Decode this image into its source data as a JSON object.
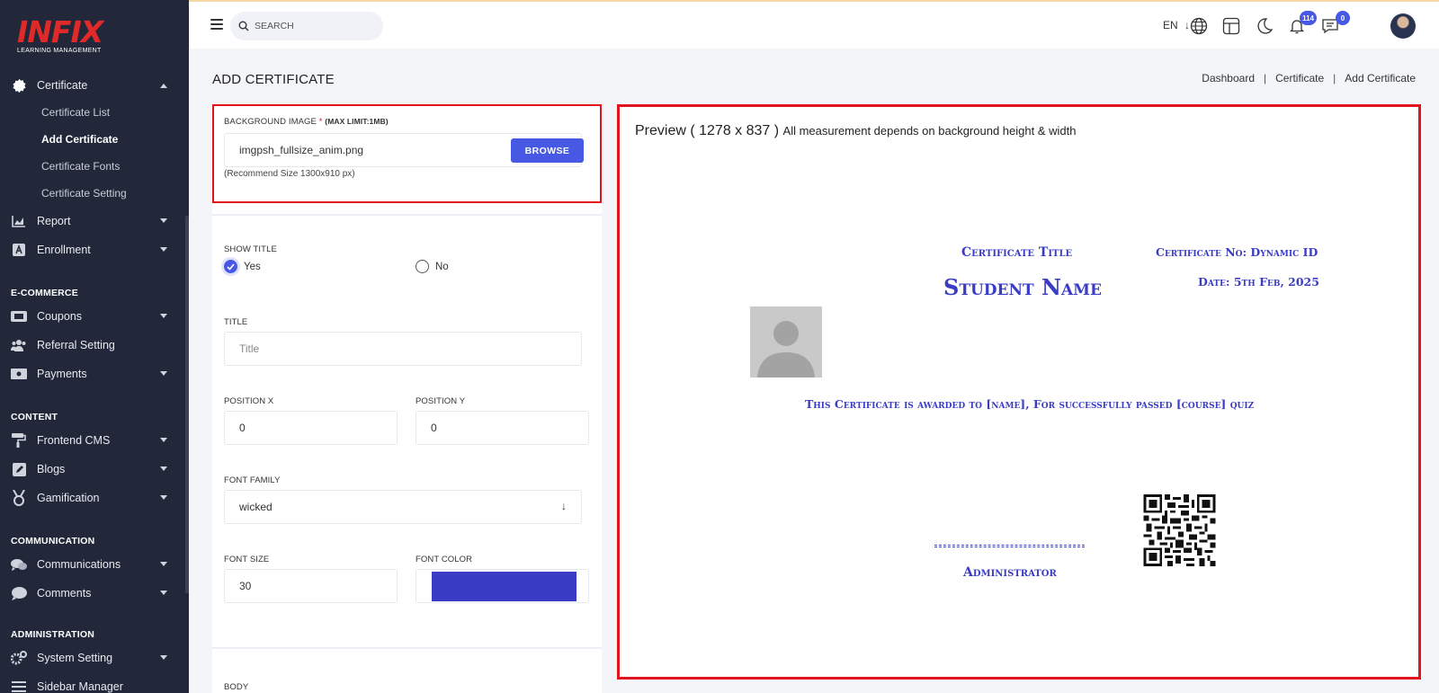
{
  "logo": {
    "mark": "INFIX",
    "subtitle": "LEARNING MANAGEMENT"
  },
  "sidebar": {
    "items": [
      {
        "label": "Certificate",
        "icon": "certificate-icon"
      },
      {
        "label": "Report",
        "icon": "chart-icon"
      },
      {
        "label": "Enrollment",
        "icon": "enrollment-icon"
      },
      {
        "label": "Coupons",
        "icon": "ticket-icon"
      },
      {
        "label": "Referral Setting",
        "icon": "users-icon"
      },
      {
        "label": "Payments",
        "icon": "money-icon"
      },
      {
        "label": "Frontend CMS",
        "icon": "paint-roller-icon"
      },
      {
        "label": "Blogs",
        "icon": "edit-icon"
      },
      {
        "label": "Gamification",
        "icon": "medal-icon"
      },
      {
        "label": "Communications",
        "icon": "chat-icon"
      },
      {
        "label": "Comments",
        "icon": "comment-icon"
      },
      {
        "label": "System Setting",
        "icon": "cogs-icon"
      },
      {
        "label": "Sidebar Manager",
        "icon": "list-icon"
      }
    ],
    "certificate_sub": [
      "Certificate List",
      "Add Certificate",
      "Certificate Fonts",
      "Certificate Setting"
    ],
    "active_sub": "Add Certificate",
    "sections": [
      "E-COMMERCE",
      "CONTENT",
      "COMMUNICATION",
      "ADMINISTRATION"
    ]
  },
  "topbar": {
    "search_placeholder": "SEARCH",
    "lang": "EN",
    "notifications_count": "114",
    "messages_count": "0"
  },
  "page": {
    "title": "ADD CERTIFICATE",
    "breadcrumb": [
      "Dashboard",
      "Certificate",
      "Add Certificate"
    ]
  },
  "form": {
    "bg_label": "BACKGROUND IMAGE",
    "bg_required": "*",
    "bg_limit": "(MAX LIMIT:1MB)",
    "bg_value": "imgpsh_fullsize_anim.png",
    "browse_label": "BROWSE",
    "bg_hint": "(Recommend Size 1300x910 px)",
    "show_title_label": "SHOW TITLE",
    "yes_label": "Yes",
    "no_label": "No",
    "show_title_selected": "Yes",
    "title_label": "TITLE",
    "title_placeholder": "Title",
    "posx_label": "POSITION X",
    "posx_value": "0",
    "posy_label": "POSITION Y",
    "posy_value": "0",
    "font_family_label": "FONT FAMILY",
    "font_family_value": "wicked",
    "font_size_label": "FONT SIZE",
    "font_size_value": "30",
    "font_color_label": "FONT COLOR",
    "font_color_value": "#3a3cc5",
    "body_label": "BODY"
  },
  "preview": {
    "heading": "Preview ( 1278 x 837 )",
    "note": "All measurement depends on background height & width",
    "cert_title": "Certificate Title",
    "cert_no": "Certificate No: Dynamic ID",
    "student_name": "Student Name",
    "date": "Date: 5th Feb, 2025",
    "body_text": "This Certificate is awarded to [name], For successfully passed [course] quiz",
    "signature_label": "Administrator"
  },
  "colors": {
    "accent": "#4759e4",
    "highlight": "#e2131b",
    "sidebar_bg": "#22283a",
    "cert_text": "#3a3cc5"
  }
}
